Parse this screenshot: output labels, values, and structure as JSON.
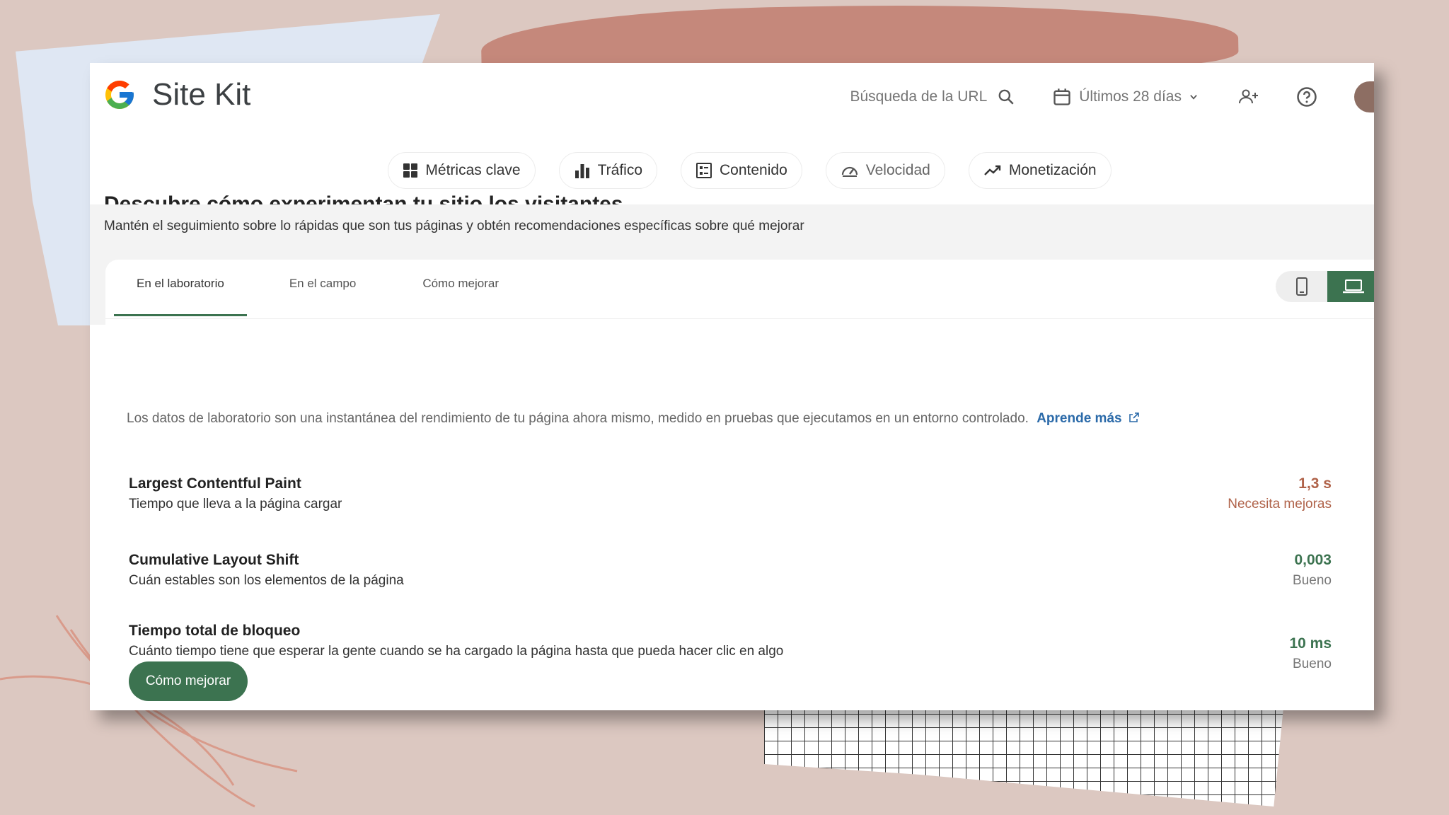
{
  "app": {
    "title": "Site Kit"
  },
  "header": {
    "search_label": "Búsqueda de la URL",
    "date_range": "Últimos 28 días"
  },
  "nav": {
    "tabs": [
      {
        "label": "Métricas clave",
        "icon": "grid-icon"
      },
      {
        "label": "Tráfico",
        "icon": "bar-chart-icon"
      },
      {
        "label": "Contenido",
        "icon": "content-list-icon"
      },
      {
        "label": "Velocidad",
        "icon": "speedometer-icon"
      },
      {
        "label": "Monetización",
        "icon": "trend-up-icon"
      }
    ]
  },
  "section": {
    "title": "Descubre cómo experimentan tu sitio los visitantes",
    "subtitle": "Mantén el seguimiento sobre lo rápidas que son tus páginas y obtén recomendaciones específicas sobre qué mejorar"
  },
  "panel": {
    "tabs": [
      "En el laboratorio",
      "En el campo",
      "Cómo mejorar"
    ],
    "active_tab": "En el laboratorio",
    "device": "desktop",
    "description": "Los datos de laboratorio son una instantánea del rendimiento de tu página ahora mismo, medido en pruebas que ejecutamos en un entorno controlado.",
    "learn_more": "Aprende más",
    "metrics": [
      {
        "name": "Largest Contentful Paint",
        "desc": "Tiempo que lleva a la página cargar",
        "value": "1,3 s",
        "status": "Necesita mejoras",
        "tone": "warn"
      },
      {
        "name": "Cumulative Layout Shift",
        "desc": "Cuán estables son los elementos de la página",
        "value": "0,003",
        "status": "Bueno",
        "tone": "good"
      },
      {
        "name": "Tiempo total de bloqueo",
        "desc": "Cuánto tiempo tiene que esperar la gente cuando se ha cargado la página hasta que pueda hacer clic en algo",
        "value": "10 ms",
        "status": "Bueno",
        "tone": "good"
      }
    ],
    "improve_button": "Cómo mejorar"
  },
  "colors": {
    "accent": "#3c7350",
    "warn": "#b0634a",
    "link": "#2b6aa9",
    "background": "#dcc8c1"
  }
}
